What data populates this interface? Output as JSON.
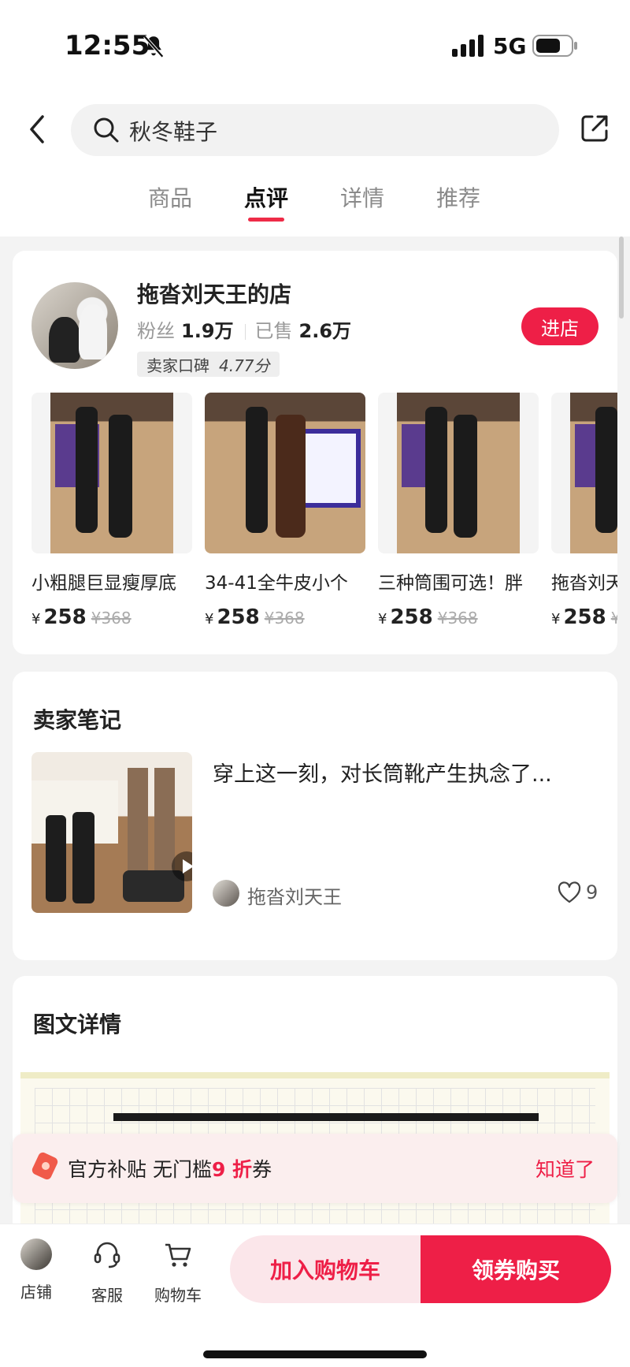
{
  "status_bar": {
    "time": "12:55",
    "network": "5G"
  },
  "search": {
    "query": "秋冬鞋子"
  },
  "tabs": [
    {
      "label": "商品"
    },
    {
      "label": "点评"
    },
    {
      "label": "详情"
    },
    {
      "label": "推荐"
    }
  ],
  "active_tab": "点评",
  "shop": {
    "name": "拖沓刘天王的店",
    "fans_label": "粉丝",
    "fans_value": "1.9万",
    "sold_label": "已售",
    "sold_value": "2.6万",
    "rating_label": "卖家口碑",
    "rating_value": "4.77分",
    "enter_label": "进店"
  },
  "products": [
    {
      "title": "小粗腿巨显瘦厚底",
      "currency": "¥",
      "price": "258",
      "old_price": "¥368"
    },
    {
      "title": "34-41全牛皮小个",
      "currency": "¥",
      "price": "258",
      "old_price": "¥368"
    },
    {
      "title": "三种筒围可选！胖",
      "currency": "¥",
      "price": "258",
      "old_price": "¥368"
    },
    {
      "title": "拖沓刘天",
      "currency": "¥",
      "price": "258",
      "old_price": "¥"
    }
  ],
  "notes": {
    "title": "卖家笔记",
    "text": "穿上这一刻，对长筒靴产生执念了...",
    "author": "拖沓刘天王",
    "likes": "9"
  },
  "detail": {
    "title": "图文详情"
  },
  "coupon": {
    "prefix": "官方补贴  无门槛",
    "highlight": "9 折",
    "suffix": "券",
    "dismiss": "知道了"
  },
  "bottom_bar": {
    "shop": "店铺",
    "service": "客服",
    "cart": "购物车",
    "add_to_cart": "加入购物车",
    "buy": "领券购买"
  },
  "colors": {
    "accent": "#ee1f47",
    "active_underline": "#ee2b47"
  }
}
